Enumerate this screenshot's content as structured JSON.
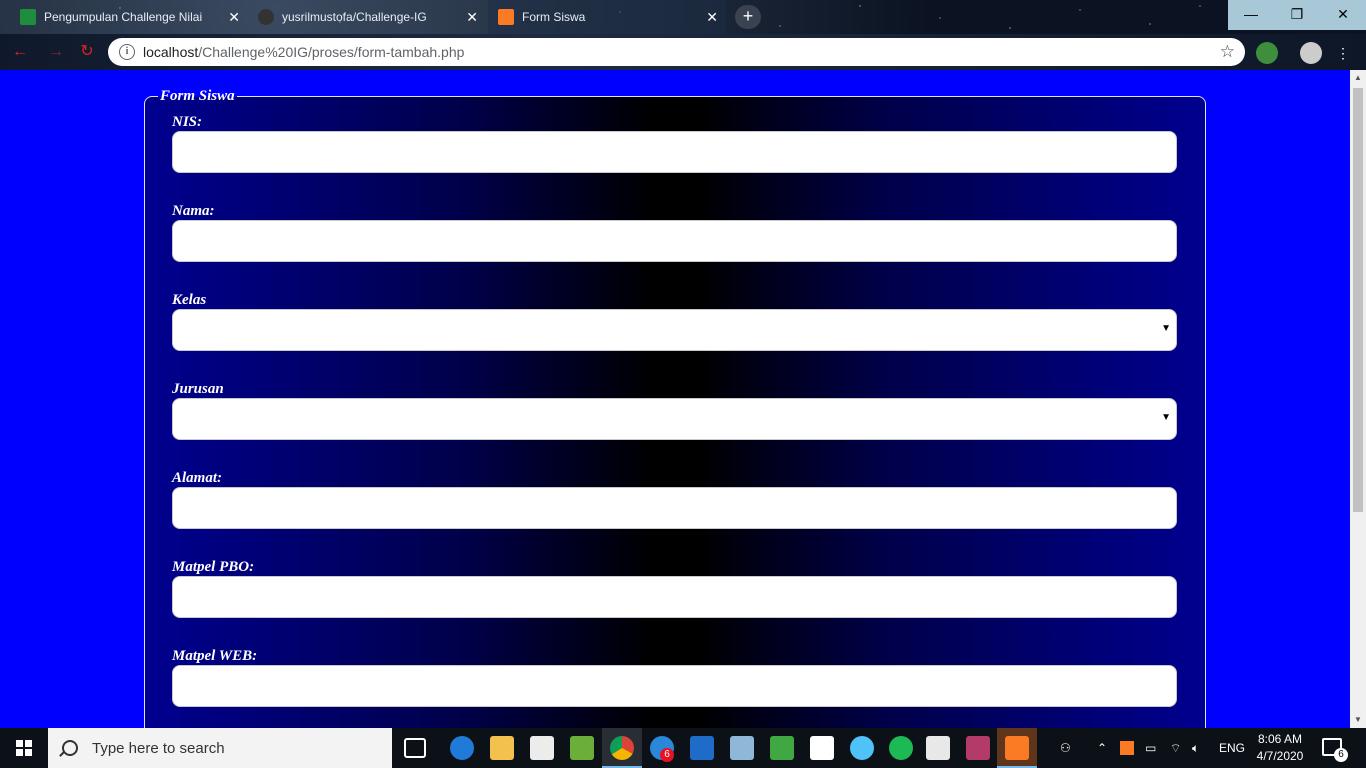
{
  "browser": {
    "tabs": [
      {
        "title": "Pengumpulan Challenge Nilai",
        "favicon": "classroom-icon",
        "color": "#1e8e3e"
      },
      {
        "title": "yusrilmustofa/Challenge-IG",
        "favicon": "github-icon",
        "color": "#333333"
      },
      {
        "title": "Form Siswa",
        "favicon": "xampp-icon",
        "color": "#fb7a24"
      }
    ],
    "new_tab": "+",
    "url_host": "localhost",
    "url_path": "/Challenge%20IG/proses/form-tambah.php"
  },
  "form": {
    "legend": "Form Siswa",
    "fields": [
      {
        "label": "NIS:",
        "type": "input"
      },
      {
        "label": "Nama:",
        "type": "input"
      },
      {
        "label": "Kelas",
        "type": "select"
      },
      {
        "label": "Jurusan",
        "type": "select"
      },
      {
        "label": "Alamat:",
        "type": "input"
      },
      {
        "label": "Matpel PBO:",
        "type": "input"
      },
      {
        "label": "Matpel WEB:",
        "type": "input"
      }
    ]
  },
  "taskbar": {
    "search_placeholder": "Type here to search",
    "language": "ENG",
    "time": "8:06 AM",
    "date": "4/7/2020",
    "notification_count": "6",
    "mail_badge": "6"
  },
  "colors": {
    "page_background": "#0000ff",
    "form_gradient_edge": "#00008f",
    "form_gradient_center": "#000000"
  }
}
